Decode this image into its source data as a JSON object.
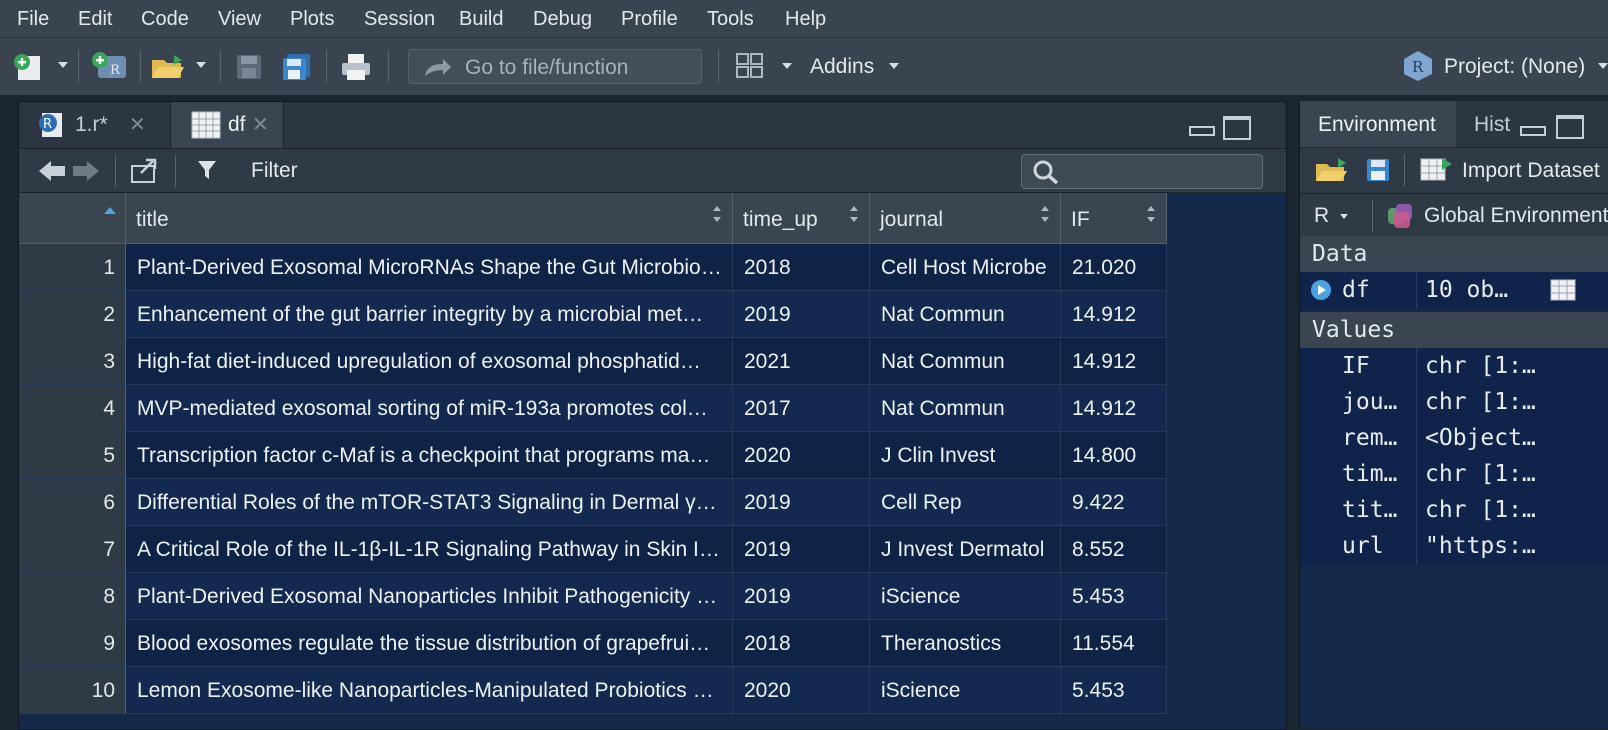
{
  "menu": [
    "File",
    "Edit",
    "Code",
    "View",
    "Plots",
    "Session",
    "Build",
    "Debug",
    "Profile",
    "Tools",
    "Help"
  ],
  "toolbar": {
    "goto_placeholder": "Go to file/function",
    "addins_label": "Addins",
    "project_label": "Project: (None)"
  },
  "source_tabs": [
    {
      "label": "1.r*",
      "icon": "r-file-icon"
    },
    {
      "label": "df",
      "icon": "table-icon"
    }
  ],
  "viewer": {
    "filter_label": "Filter",
    "search_placeholder": "",
    "columns": [
      "title",
      "time_up",
      "journal",
      "IF"
    ],
    "rows": [
      {
        "idx": "1",
        "title": "Plant-Derived Exosomal MicroRNAs Shape the Gut Microbio…",
        "time_up": "2018",
        "journal": "Cell Host Microbe",
        "IF": "21.020"
      },
      {
        "idx": "2",
        "title": "Enhancement of the gut barrier integrity by a microbial met…",
        "time_up": "2019",
        "journal": "Nat Commun",
        "IF": "14.912"
      },
      {
        "idx": "3",
        "title": "High-fat diet-induced upregulation of exosomal phosphatid…",
        "time_up": "2021",
        "journal": "Nat Commun",
        "IF": "14.912"
      },
      {
        "idx": "4",
        "title": "MVP-mediated exosomal sorting of miR-193a promotes col…",
        "time_up": "2017",
        "journal": "Nat Commun",
        "IF": "14.912"
      },
      {
        "idx": "5",
        "title": "Transcription factor c-Maf is a checkpoint that programs ma…",
        "time_up": "2020",
        "journal": "J Clin Invest",
        "IF": "14.800"
      },
      {
        "idx": "6",
        "title": "Differential Roles of the mTOR-STAT3 Signaling in Dermal γ…",
        "time_up": "2019",
        "journal": "Cell Rep",
        "IF": "9.422"
      },
      {
        "idx": "7",
        "title": "A Critical Role of the IL-1β-IL-1R Signaling Pathway in Skin I…",
        "time_up": "2019",
        "journal": "J Invest Dermatol",
        "IF": "8.552"
      },
      {
        "idx": "8",
        "title": "Plant-Derived Exosomal Nanoparticles Inhibit Pathogenicity …",
        "time_up": "2019",
        "journal": "iScience",
        "IF": "5.453"
      },
      {
        "idx": "9",
        "title": "Blood exosomes regulate the tissue distribution of grapefrui…",
        "time_up": "2018",
        "journal": "Theranostics",
        "IF": "11.554"
      },
      {
        "idx": "10",
        "title": "Lemon Exosome-like Nanoparticles-Manipulated Probiotics …",
        "time_up": "2020",
        "journal": "iScience",
        "IF": "5.453"
      }
    ]
  },
  "env": {
    "tabs": [
      "Environment",
      "Hist"
    ],
    "import_label": "Import Dataset",
    "lang_label": "R",
    "scope_label": "Global Environment",
    "data_header": "Data",
    "data_rows": [
      {
        "name": "df",
        "value": "10 ob…"
      }
    ],
    "values_header": "Values",
    "value_rows": [
      {
        "name": "IF",
        "value": "chr [1:…"
      },
      {
        "name": "jou…",
        "value": "chr [1:…"
      },
      {
        "name": "rem…",
        "value": "<Object…"
      },
      {
        "name": "tim…",
        "value": "chr [1:…"
      },
      {
        "name": "tit…",
        "value": "chr [1:…"
      },
      {
        "name": "url",
        "value": "\"https:…"
      }
    ]
  },
  "colors": {
    "accent": "#4aa3e0",
    "grid_bg": "#0f2347",
    "header_bg": "#3a4551"
  }
}
